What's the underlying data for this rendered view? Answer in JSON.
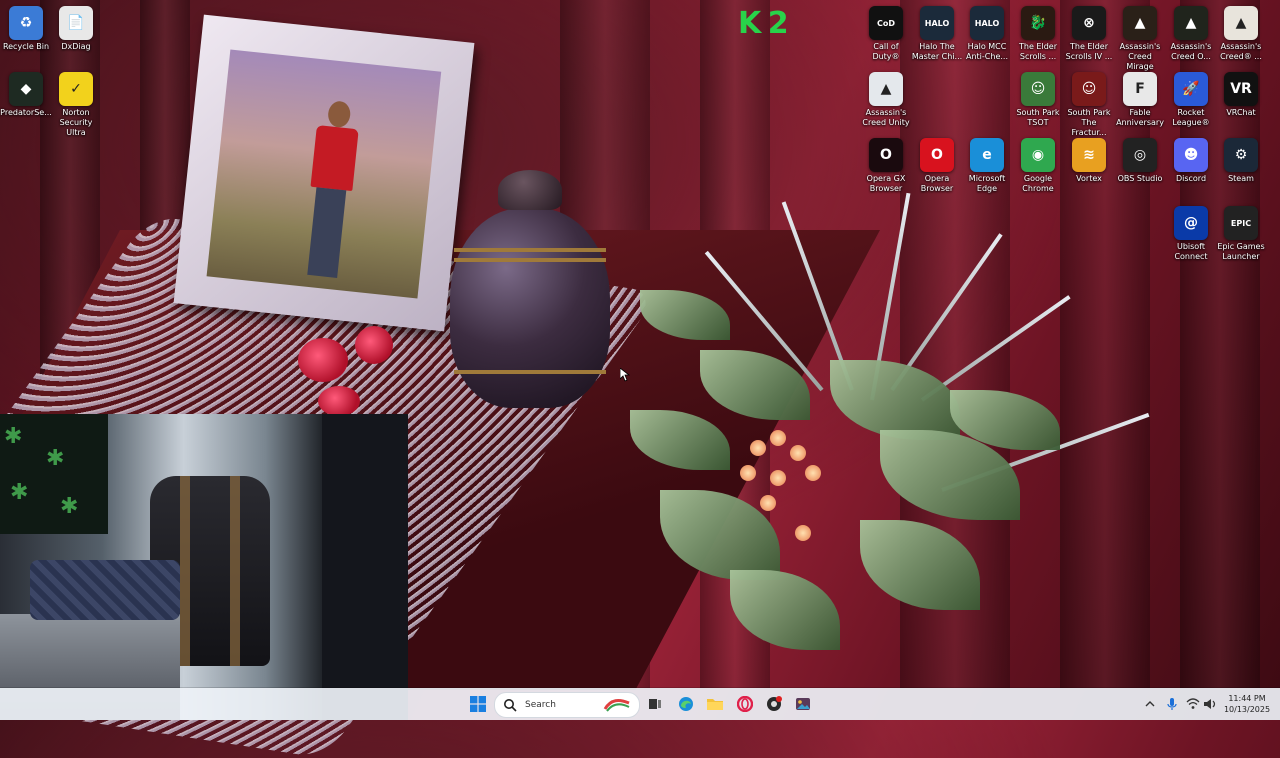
{
  "desktop": {
    "icons": [
      {
        "id": "recycle-bin",
        "label": "Recycle Bin",
        "color": "#3b7bd6",
        "glyph": "♻"
      },
      {
        "id": "dxdiag",
        "label": "DxDiag",
        "color": "#e8e8e8",
        "glyph": "📄"
      },
      {
        "id": "predatorsense",
        "label": "PredatorSe...",
        "color": "#1e2a22",
        "glyph": "◆"
      },
      {
        "id": "norton",
        "label": "Norton\nSecurity Ultra",
        "color": "#f2d21c",
        "glyph": "✓"
      },
      {
        "id": "call-of-duty",
        "label": "Call of\nDuty®",
        "color": "#111111",
        "glyph": "CoD"
      },
      {
        "id": "halo-mcc-1",
        "label": "Halo The\nMaster Chi...",
        "color": "#1b2a3a",
        "glyph": "HALO"
      },
      {
        "id": "halo-mcc-2",
        "label": "Halo MCC\nAnti-Che...",
        "color": "#1b2a3a",
        "glyph": "HALO"
      },
      {
        "id": "elder-scrolls-1",
        "label": "The Elder\nScrolls ...",
        "color": "#2a1a12",
        "glyph": "🐉"
      },
      {
        "id": "elder-scrolls-2",
        "label": "The Elder\nScrolls IV ...",
        "color": "#1a1a1a",
        "glyph": "⊗"
      },
      {
        "id": "ac-mirage",
        "label": "Assassin's\nCreed Mirage",
        "color": "#2a2018",
        "glyph": "▲"
      },
      {
        "id": "ac-origins",
        "label": "Assassin's\nCreed O...",
        "color": "#20241c",
        "glyph": "▲"
      },
      {
        "id": "ac-other",
        "label": "Assassin's\nCreed® ...",
        "color": "#e8e4dc",
        "glyph": "▲"
      },
      {
        "id": "ac-unity",
        "label": "Assassin's\nCreed Unity",
        "color": "#e4e8ec",
        "glyph": "▲"
      },
      {
        "id": "south-park-tsot",
        "label": "South Park\nTSOT",
        "color": "#3a7a3a",
        "glyph": "☺"
      },
      {
        "id": "south-park-tfbw",
        "label": "South Park\nThe Fractur...",
        "color": "#7a1a1a",
        "glyph": "☺"
      },
      {
        "id": "fable",
        "label": "Fable\nAnniversary",
        "color": "#e8e8e8",
        "glyph": "F"
      },
      {
        "id": "rocket-league",
        "label": "Rocket\nLeague®",
        "color": "#2a5ad8",
        "glyph": "🚀"
      },
      {
        "id": "vrchat",
        "label": "VRChat",
        "color": "#111111",
        "glyph": "VR"
      },
      {
        "id": "opera-gx",
        "label": "Opera GX\nBrowser",
        "color": "#1a0a0e",
        "glyph": "O"
      },
      {
        "id": "opera",
        "label": "Opera\nBrowser",
        "color": "#d8121e",
        "glyph": "O"
      },
      {
        "id": "edge",
        "label": "Microsoft\nEdge",
        "color": "#1a8fd8",
        "glyph": "e"
      },
      {
        "id": "chrome",
        "label": "Google\nChrome",
        "color": "#2fa84f",
        "glyph": "◉"
      },
      {
        "id": "vortex",
        "label": "Vortex",
        "color": "#e8a020",
        "glyph": "≋"
      },
      {
        "id": "obs",
        "label": "OBS Studio",
        "color": "#222222",
        "glyph": "◎"
      },
      {
        "id": "discord",
        "label": "Discord",
        "color": "#5865f2",
        "glyph": "☻"
      },
      {
        "id": "steam",
        "label": "Steam",
        "color": "#1b2838",
        "glyph": "⚙"
      },
      {
        "id": "ubisoft",
        "label": "Ubisoft\nConnect",
        "color": "#0a3aa8",
        "glyph": "@"
      },
      {
        "id": "epic",
        "label": "Epic Games\nLauncher",
        "color": "#222222",
        "glyph": "EPIC"
      }
    ],
    "overlay_logo": "K 2"
  },
  "taskbar": {
    "search_placeholder": "Search",
    "apps": [
      {
        "id": "start",
        "icon": "windows-start-icon"
      },
      {
        "id": "task-view",
        "icon": "task-view-icon"
      },
      {
        "id": "edge",
        "icon": "edge-icon"
      },
      {
        "id": "file-explorer",
        "icon": "folder-icon"
      },
      {
        "id": "opera",
        "icon": "opera-icon"
      },
      {
        "id": "obs-recording",
        "icon": "obs-recording-icon"
      },
      {
        "id": "photos",
        "icon": "photos-icon"
      }
    ],
    "tray": {
      "time": "11:44 PM",
      "date": "10/13/2025"
    }
  },
  "colors": {
    "taskbar_bg": "#eef2f7",
    "start_blue": "#1a7fe0",
    "label_text": "#ffffff"
  }
}
